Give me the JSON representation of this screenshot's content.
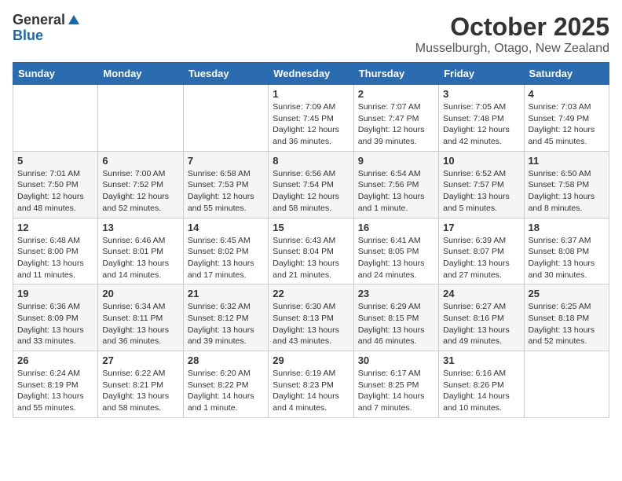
{
  "logo": {
    "general": "General",
    "blue": "Blue"
  },
  "title": "October 2025",
  "location": "Musselburgh, Otago, New Zealand",
  "days_header": [
    "Sunday",
    "Monday",
    "Tuesday",
    "Wednesday",
    "Thursday",
    "Friday",
    "Saturday"
  ],
  "weeks": [
    [
      {
        "day": "",
        "info": ""
      },
      {
        "day": "",
        "info": ""
      },
      {
        "day": "",
        "info": ""
      },
      {
        "day": "1",
        "info": "Sunrise: 7:09 AM\nSunset: 7:45 PM\nDaylight: 12 hours\nand 36 minutes."
      },
      {
        "day": "2",
        "info": "Sunrise: 7:07 AM\nSunset: 7:47 PM\nDaylight: 12 hours\nand 39 minutes."
      },
      {
        "day": "3",
        "info": "Sunrise: 7:05 AM\nSunset: 7:48 PM\nDaylight: 12 hours\nand 42 minutes."
      },
      {
        "day": "4",
        "info": "Sunrise: 7:03 AM\nSunset: 7:49 PM\nDaylight: 12 hours\nand 45 minutes."
      }
    ],
    [
      {
        "day": "5",
        "info": "Sunrise: 7:01 AM\nSunset: 7:50 PM\nDaylight: 12 hours\nand 48 minutes."
      },
      {
        "day": "6",
        "info": "Sunrise: 7:00 AM\nSunset: 7:52 PM\nDaylight: 12 hours\nand 52 minutes."
      },
      {
        "day": "7",
        "info": "Sunrise: 6:58 AM\nSunset: 7:53 PM\nDaylight: 12 hours\nand 55 minutes."
      },
      {
        "day": "8",
        "info": "Sunrise: 6:56 AM\nSunset: 7:54 PM\nDaylight: 12 hours\nand 58 minutes."
      },
      {
        "day": "9",
        "info": "Sunrise: 6:54 AM\nSunset: 7:56 PM\nDaylight: 13 hours\nand 1 minute."
      },
      {
        "day": "10",
        "info": "Sunrise: 6:52 AM\nSunset: 7:57 PM\nDaylight: 13 hours\nand 5 minutes."
      },
      {
        "day": "11",
        "info": "Sunrise: 6:50 AM\nSunset: 7:58 PM\nDaylight: 13 hours\nand 8 minutes."
      }
    ],
    [
      {
        "day": "12",
        "info": "Sunrise: 6:48 AM\nSunset: 8:00 PM\nDaylight: 13 hours\nand 11 minutes."
      },
      {
        "day": "13",
        "info": "Sunrise: 6:46 AM\nSunset: 8:01 PM\nDaylight: 13 hours\nand 14 minutes."
      },
      {
        "day": "14",
        "info": "Sunrise: 6:45 AM\nSunset: 8:02 PM\nDaylight: 13 hours\nand 17 minutes."
      },
      {
        "day": "15",
        "info": "Sunrise: 6:43 AM\nSunset: 8:04 PM\nDaylight: 13 hours\nand 21 minutes."
      },
      {
        "day": "16",
        "info": "Sunrise: 6:41 AM\nSunset: 8:05 PM\nDaylight: 13 hours\nand 24 minutes."
      },
      {
        "day": "17",
        "info": "Sunrise: 6:39 AM\nSunset: 8:07 PM\nDaylight: 13 hours\nand 27 minutes."
      },
      {
        "day": "18",
        "info": "Sunrise: 6:37 AM\nSunset: 8:08 PM\nDaylight: 13 hours\nand 30 minutes."
      }
    ],
    [
      {
        "day": "19",
        "info": "Sunrise: 6:36 AM\nSunset: 8:09 PM\nDaylight: 13 hours\nand 33 minutes."
      },
      {
        "day": "20",
        "info": "Sunrise: 6:34 AM\nSunset: 8:11 PM\nDaylight: 13 hours\nand 36 minutes."
      },
      {
        "day": "21",
        "info": "Sunrise: 6:32 AM\nSunset: 8:12 PM\nDaylight: 13 hours\nand 39 minutes."
      },
      {
        "day": "22",
        "info": "Sunrise: 6:30 AM\nSunset: 8:13 PM\nDaylight: 13 hours\nand 43 minutes."
      },
      {
        "day": "23",
        "info": "Sunrise: 6:29 AM\nSunset: 8:15 PM\nDaylight: 13 hours\nand 46 minutes."
      },
      {
        "day": "24",
        "info": "Sunrise: 6:27 AM\nSunset: 8:16 PM\nDaylight: 13 hours\nand 49 minutes."
      },
      {
        "day": "25",
        "info": "Sunrise: 6:25 AM\nSunset: 8:18 PM\nDaylight: 13 hours\nand 52 minutes."
      }
    ],
    [
      {
        "day": "26",
        "info": "Sunrise: 6:24 AM\nSunset: 8:19 PM\nDaylight: 13 hours\nand 55 minutes."
      },
      {
        "day": "27",
        "info": "Sunrise: 6:22 AM\nSunset: 8:21 PM\nDaylight: 13 hours\nand 58 minutes."
      },
      {
        "day": "28",
        "info": "Sunrise: 6:20 AM\nSunset: 8:22 PM\nDaylight: 14 hours\nand 1 minute."
      },
      {
        "day": "29",
        "info": "Sunrise: 6:19 AM\nSunset: 8:23 PM\nDaylight: 14 hours\nand 4 minutes."
      },
      {
        "day": "30",
        "info": "Sunrise: 6:17 AM\nSunset: 8:25 PM\nDaylight: 14 hours\nand 7 minutes."
      },
      {
        "day": "31",
        "info": "Sunrise: 6:16 AM\nSunset: 8:26 PM\nDaylight: 14 hours\nand 10 minutes."
      },
      {
        "day": "",
        "info": ""
      }
    ]
  ]
}
